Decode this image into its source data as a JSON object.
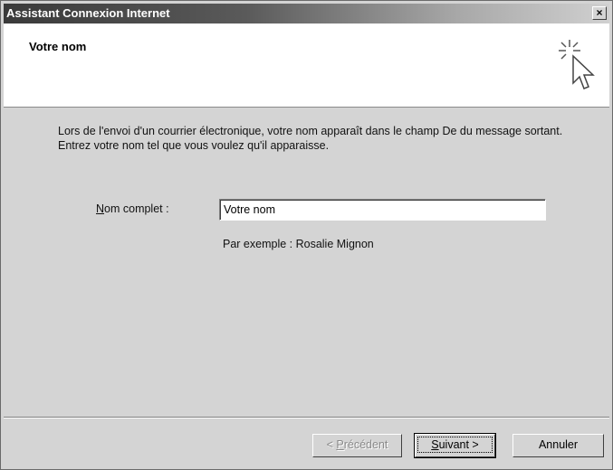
{
  "window": {
    "title": "Assistant Connexion Internet",
    "close_glyph": "×"
  },
  "header": {
    "title": "Votre nom",
    "icon": "wizard-cursor-icon"
  },
  "body": {
    "intro_text": "Lors de l'envoi d'un courrier électronique, votre nom apparaît dans le champ De du message sortant. Entrez votre nom tel que vous voulez qu'il apparaisse.",
    "field_label_first": "N",
    "field_label_rest": "om complet :",
    "field_value": "Votre nom",
    "example_text": "Par exemple : Rosalie Mignon"
  },
  "buttons": {
    "prev_lt": "< ",
    "prev_first": "P",
    "prev_rest": "récédent",
    "next_first": "S",
    "next_rest": "uivant >",
    "cancel": "Annuler"
  }
}
